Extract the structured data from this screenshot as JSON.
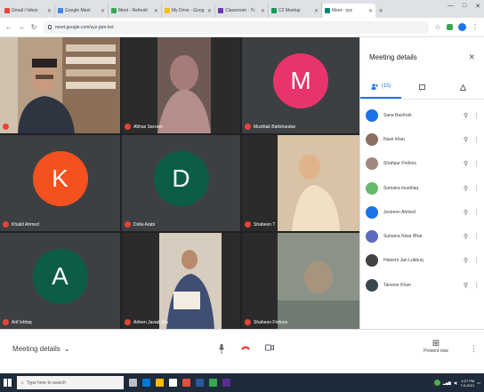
{
  "browser": {
    "tabs": [
      {
        "label": "Gmail / Inbox",
        "color": "#ea4335"
      },
      {
        "label": "Google Meet",
        "color": "#4285f4"
      },
      {
        "label": "Meet - Refresh",
        "color": "#34a853"
      },
      {
        "label": "My Drive - Goog",
        "color": "#fbbc04"
      },
      {
        "label": "Classroom - 7c",
        "color": "#673ab7"
      },
      {
        "label": "C2 Meetup",
        "color": "#0f9d58"
      },
      {
        "label": "Meet - xyz",
        "color": "#00897b",
        "active": true
      }
    ],
    "url": "meet.google.com/xyz-jqrn-bvt",
    "window_controls": [
      "—",
      "□",
      "✕"
    ]
  },
  "tiles": [
    {
      "name": "",
      "kind": "video-host"
    },
    {
      "name": "Abhas Sarvam",
      "kind": "video-girl"
    },
    {
      "name": "Mushtak Bailoharatar",
      "kind": "avatar",
      "letter": "M",
      "color": "#e8336b"
    },
    {
      "name": "Khalid Ahmed",
      "kind": "avatar",
      "letter": "K",
      "color": "#f4511e"
    },
    {
      "name": "Dolla Arabi",
      "kind": "avatar",
      "letter": "D",
      "color": "#0b5d47"
    },
    {
      "name": "Shabeen T",
      "kind": "video-child"
    },
    {
      "name": "Arif Ishfaq",
      "kind": "avatar",
      "letter": "A",
      "color": "#0b5d47"
    },
    {
      "name": "Arfeen Javad Jha",
      "kind": "video-woman"
    },
    {
      "name": "Shaheen Firdoos",
      "kind": "video-dim"
    }
  ],
  "sidebar": {
    "title": "Meeting details",
    "tabs": [
      {
        "label": "(15)",
        "icon": "people-icon"
      },
      {
        "label": "",
        "icon": "chat-icon"
      },
      {
        "label": "",
        "icon": "activities-icon"
      }
    ],
    "participants": [
      {
        "name": "Sana Bashrah",
        "color": "#1a73e8"
      },
      {
        "name": "Nasir khan",
        "color": "#8d6e63"
      },
      {
        "name": "Shahpur Firdoos",
        "color": "#a1887f"
      },
      {
        "name": "Sumaira mushtaq",
        "color": "#66bb6a"
      },
      {
        "name": "Jesireen Ahmed",
        "color": "#1a73e8"
      },
      {
        "name": "Suhama Nisar Bhat",
        "color": "#5c6bc0"
      },
      {
        "name": "Haleem Jan Lubbuq",
        "color": "#424242"
      },
      {
        "name": "Tanveer Khan",
        "color": "#37474f"
      }
    ]
  },
  "bottom_bar": {
    "meeting_details": "Meeting details",
    "present_label": "Present now"
  },
  "taskbar": {
    "search_placeholder": "Type here to search",
    "time": "4:27 PM",
    "date": "7-6-2021"
  }
}
